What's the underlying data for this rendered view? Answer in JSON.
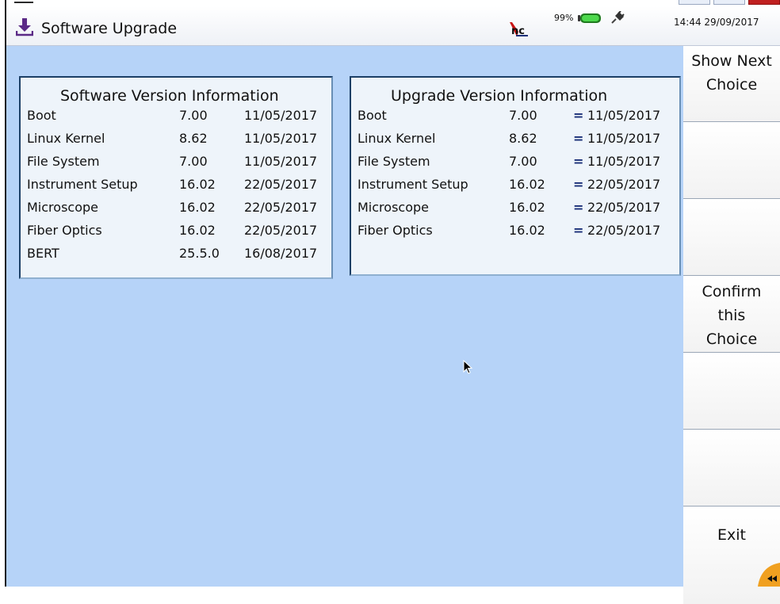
{
  "header": {
    "title": "Software Upgrade",
    "battery_percent": "99%",
    "time_date": "14:44  29/09/2017",
    "battery_level": 0.99,
    "accent_color": "#5b2a86"
  },
  "software_panel": {
    "title": "Software Version Information",
    "rows": [
      {
        "name": "Boot",
        "version": "7.00",
        "date": "11/05/2017"
      },
      {
        "name": "Linux Kernel",
        "version": "8.62",
        "date": "11/05/2017"
      },
      {
        "name": "File System",
        "version": "7.00",
        "date": "11/05/2017"
      },
      {
        "name": "Instrument Setup",
        "version": "16.02",
        "date": "22/05/2017"
      },
      {
        "name": "Microscope",
        "version": "16.02",
        "date": "22/05/2017"
      },
      {
        "name": "Fiber Optics",
        "version": "16.02",
        "date": "22/05/2017"
      },
      {
        "name": "BERT",
        "version": "25.5.0",
        "date": "16/08/2017"
      }
    ]
  },
  "upgrade_panel": {
    "title": "Upgrade Version Information",
    "rows": [
      {
        "name": "Boot",
        "version": "7.00",
        "marker": "=",
        "date": "11/05/2017"
      },
      {
        "name": "Linux Kernel",
        "version": "8.62",
        "marker": "=",
        "date": "11/05/2017"
      },
      {
        "name": "File System",
        "version": "7.00",
        "marker": "=",
        "date": "11/05/2017"
      },
      {
        "name": "Instrument Setup",
        "version": "16.02",
        "marker": "=",
        "date": "22/05/2017"
      },
      {
        "name": "Microscope",
        "version": "16.02",
        "marker": "=",
        "date": "22/05/2017"
      },
      {
        "name": "Fiber Optics",
        "version": "16.02",
        "marker": "=",
        "date": "22/05/2017"
      }
    ]
  },
  "side_menu": {
    "buttons": [
      "Show Next\nChoice",
      "",
      "",
      "Confirm\nthis\nChoice",
      "",
      "",
      "Exit"
    ]
  }
}
